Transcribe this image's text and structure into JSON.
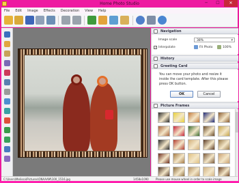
{
  "window": {
    "title": "Home Photo Studio",
    "min_glyph": "─",
    "max_glyph": "☐",
    "close_glyph": "✕"
  },
  "menu": [
    "File",
    "Edit",
    "Image",
    "Effects",
    "Decoration",
    "View",
    "Help"
  ],
  "toolbar_icons": [
    "open-folder-icon",
    "photo-icon",
    "save-icon",
    "print-icon",
    "scan-icon",
    "undo-icon",
    "redo-icon",
    "text-icon",
    "palette-icon",
    "landscape-icon",
    "crop-icon",
    "help-icon",
    "settings-icon",
    "info-icon"
  ],
  "left_tools": [
    "arrow-tool-icon",
    "brush-tool-icon",
    "zoom-tool-icon",
    "pen-tool-icon",
    "clone-tool-icon",
    "fill-tool-icon",
    "eraser-tool-icon",
    "shape-tool-icon",
    "eye-tool-icon",
    "color-tool-icon",
    "layers-tool-icon",
    "rotate-tool-icon",
    "flip-tool-icon",
    "crop-tool-icon"
  ],
  "status": {
    "path": "C:\\Users\\Melissa\\Pictures\\ONAAAM\\100_1516.jpg",
    "dims": "1458x1090",
    "hint": "Please use mouse wheel in order to scale image"
  },
  "navigation": {
    "title": "Navigation",
    "image_scale_label": "Image scale",
    "image_scale_value": "38%",
    "interpolate_label": "Interpolate",
    "interpolate_checked": true,
    "fit_photo_label": "Fit Photo",
    "zoom_100_label": "100%"
  },
  "history": {
    "title": "History"
  },
  "greeting": {
    "title": "Greeting Card",
    "text": "You can move your photo and resize it inside the card template. After this please press OK button.",
    "ok_label": "OK",
    "cancel_label": "Cancel"
  },
  "frames": {
    "title": "Picture Frames",
    "thumb_colors": [
      "#2b2b2b",
      "#e9d13a",
      "#c27a3b",
      "#1e2a7a",
      "#8a5b2f",
      "#a8643a",
      "#c8243a",
      "#3b6b2e",
      "#6a4b2a",
      "#c7a54a",
      "#2a2a2a",
      "#b33b2f",
      "#d3b07a",
      "#5a3a24",
      "#9a7a4a",
      "#6b2a1a",
      "#a47a45",
      "#e0c080",
      "#7a5a3a",
      "#c9a070",
      "#4a3020",
      "#8a6a3a",
      "#b59060",
      "#d0b080",
      "#6a4020"
    ]
  }
}
